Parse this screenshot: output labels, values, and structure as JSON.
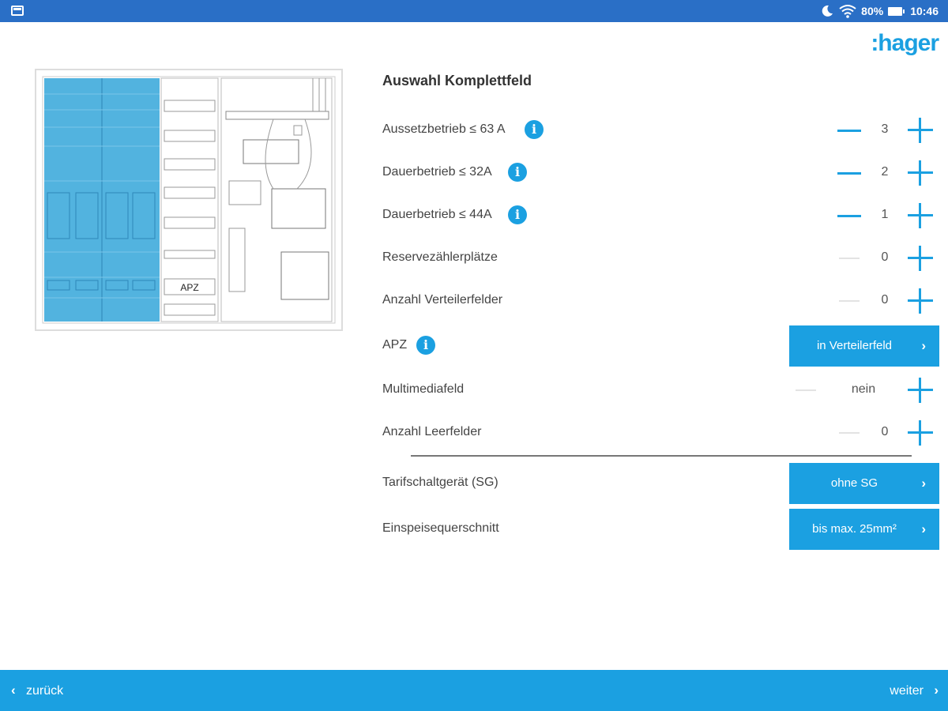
{
  "status_bar": {
    "battery_percent": "80%",
    "time": "10:46",
    "icons": [
      "app-icon",
      "moon-icon",
      "wifi-icon",
      "battery-icon"
    ]
  },
  "brand": {
    "logo_text": ":hager",
    "color": "#1ba0e1"
  },
  "diagram": {
    "apz_label": "APZ"
  },
  "section": {
    "title": "Auswahl Komplettfeld"
  },
  "options": [
    {
      "label": "Aussetzbetrieb ≤ 63 A",
      "info": "i",
      "value": "3"
    },
    {
      "label": "Dauerbetrieb ≤ 32A",
      "info": "i",
      "value": "2"
    },
    {
      "label": "Dauerbetrieb ≤ 44A",
      "info": "i",
      "value": "1"
    },
    {
      "label": "Reservezählerplätze",
      "value": "0"
    },
    {
      "label": "Anzahl Verteilerfelder",
      "value": "0"
    },
    {
      "label": "APZ",
      "info": "i",
      "select": "in Verteilerfeld"
    },
    {
      "label": "Multimediafeld",
      "value": "nein"
    },
    {
      "label": "Anzahl Leerfelder",
      "value": "0"
    },
    {
      "label": "Tarifschaltgerät (SG)",
      "select": "ohne SG"
    },
    {
      "label": "Einspeisequerschnitt",
      "select": "bis max. 25mm²"
    }
  ],
  "navigation": {
    "back_label": "zurück",
    "next_label": "weiter"
  },
  "colors": {
    "accent": "#1ba0e1",
    "status_bar": "#2a6fc6",
    "disabled": "#e3e3e3"
  }
}
